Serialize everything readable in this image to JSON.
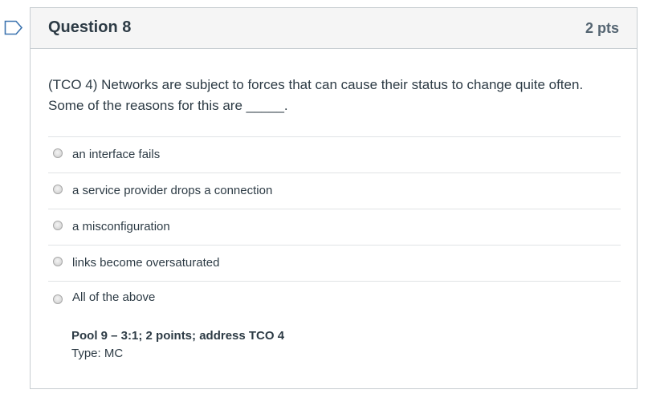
{
  "question": {
    "title": "Question 8",
    "points": "2 pts",
    "text": "(TCO 4) Networks are subject to forces that can cause their status to change quite often. Some of the reasons for this are _____.",
    "answers": [
      {
        "label": "an interface fails"
      },
      {
        "label": "a service provider drops a connection"
      },
      {
        "label": "a misconfiguration"
      },
      {
        "label": "links become oversaturated"
      },
      {
        "label": "All of the above"
      }
    ],
    "pool": "Pool 9 – 3:1; 2 points; address TCO 4",
    "type": "Type: MC"
  },
  "colors": {
    "flag": "#3b73af",
    "border": "#c7cdd1",
    "header_bg": "#f5f5f5",
    "text": "#2d3b45"
  },
  "icons": {
    "flag": "bookmark-flag-icon"
  }
}
